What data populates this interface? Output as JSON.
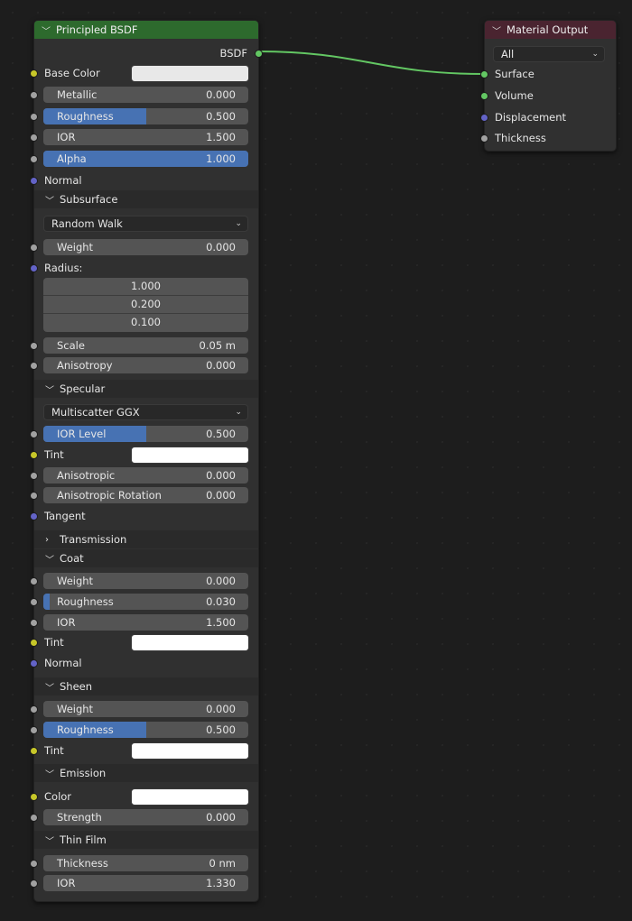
{
  "bsdf": {
    "title": "Principled BSDF",
    "output_label": "BSDF",
    "base_color": {
      "label": "Base Color",
      "color": "#e8e8e8"
    },
    "metallic": {
      "label": "Metallic",
      "value": "0.000",
      "fraction": 0
    },
    "roughness": {
      "label": "Roughness",
      "value": "0.500",
      "fraction": 0.5
    },
    "ior": {
      "label": "IOR",
      "value": "1.500",
      "fraction": 0
    },
    "alpha": {
      "label": "Alpha",
      "value": "1.000",
      "fraction": 1
    },
    "normal": "Normal",
    "subsurface": {
      "title": "Subsurface",
      "method": "Random Walk",
      "weight": {
        "label": "Weight",
        "value": "0.000",
        "fraction": 0
      },
      "radius_label": "Radius:",
      "radius": [
        "1.000",
        "0.200",
        "0.100"
      ],
      "scale": {
        "label": "Scale",
        "value": "0.05 m",
        "fraction": 0
      },
      "anisotropy": {
        "label": "Anisotropy",
        "value": "0.000",
        "fraction": 0
      }
    },
    "specular": {
      "title": "Specular",
      "distribution": "Multiscatter GGX",
      "ior_level": {
        "label": "IOR Level",
        "value": "0.500",
        "fraction": 0.5
      },
      "tint": {
        "label": "Tint",
        "color": "#ffffff"
      },
      "anisotropic": {
        "label": "Anisotropic",
        "value": "0.000",
        "fraction": 0
      },
      "anisotropic_rotation": {
        "label": "Anisotropic Rotation",
        "value": "0.000",
        "fraction": 0
      },
      "tangent": "Tangent"
    },
    "transmission": {
      "title": "Transmission"
    },
    "coat": {
      "title": "Coat",
      "weight": {
        "label": "Weight",
        "value": "0.000",
        "fraction": 0
      },
      "roughness": {
        "label": "Roughness",
        "value": "0.030",
        "fraction": 0.03
      },
      "ior": {
        "label": "IOR",
        "value": "1.500",
        "fraction": 0
      },
      "tint": {
        "label": "Tint",
        "color": "#ffffff"
      },
      "normal": "Normal"
    },
    "sheen": {
      "title": "Sheen",
      "weight": {
        "label": "Weight",
        "value": "0.000",
        "fraction": 0
      },
      "roughness": {
        "label": "Roughness",
        "value": "0.500",
        "fraction": 0.5
      },
      "tint": {
        "label": "Tint",
        "color": "#ffffff"
      }
    },
    "emission": {
      "title": "Emission",
      "color": {
        "label": "Color",
        "color": "#ffffff"
      },
      "strength": {
        "label": "Strength",
        "value": "0.000",
        "fraction": 0
      }
    },
    "thin_film": {
      "title": "Thin Film",
      "thickness": {
        "label": "Thickness",
        "value": "0 nm",
        "fraction": 0
      },
      "ior": {
        "label": "IOR",
        "value": "1.330",
        "fraction": 0
      }
    }
  },
  "output_node": {
    "title": "Material Output",
    "target": "All",
    "inputs": [
      "Surface",
      "Volume",
      "Displacement",
      "Thickness"
    ]
  },
  "colors": {
    "link": "#63c763",
    "accent": "#4772b3",
    "header_bsdf": "#2d6a2d",
    "header_output": "#4a2430"
  }
}
